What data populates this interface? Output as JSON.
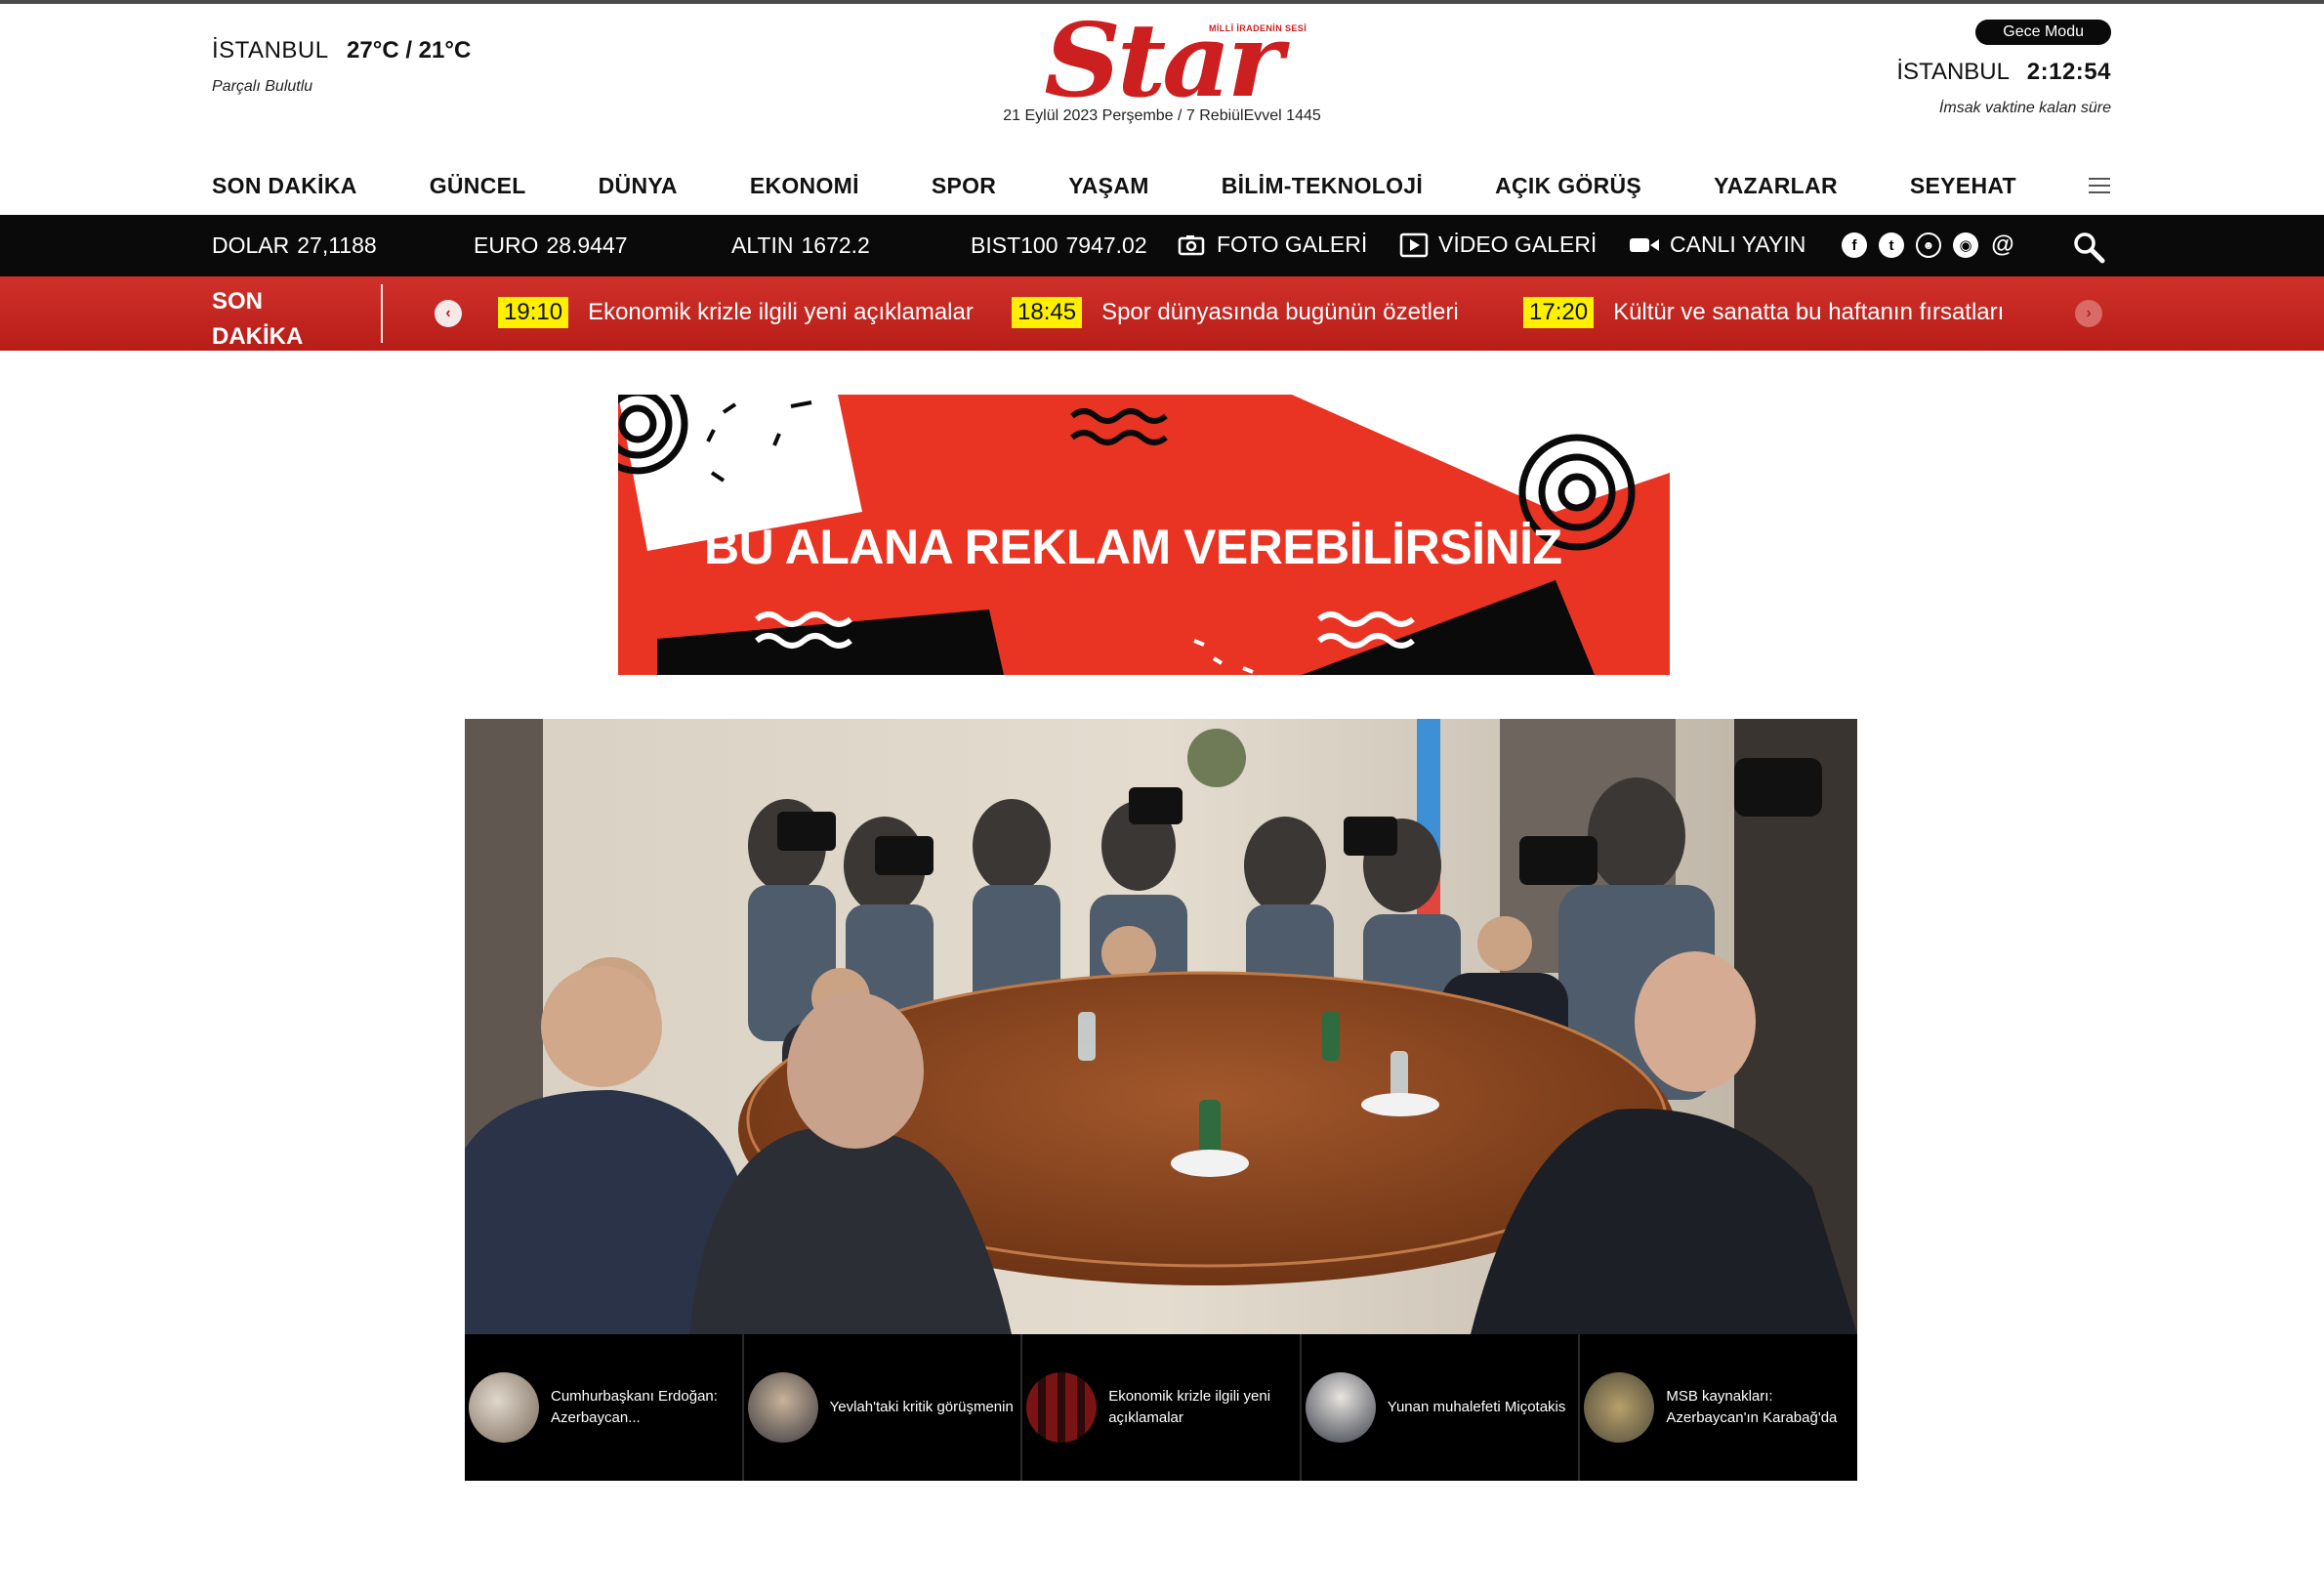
{
  "header": {
    "weather": {
      "city": "İSTANBUL",
      "temp": "27°C / 21°C",
      "desc": "Parçalı Bulutlu"
    },
    "logo": {
      "text": "Star",
      "slogan": "MİLLİ İRADENİN SESİ"
    },
    "date": "21 Eylül 2023 Perşembe / 7 RebiülEvvel 1445",
    "night_mode": "Gece Modu",
    "clock": {
      "city": "İSTANBUL",
      "time": "2:12:54",
      "label": "İmsak vaktine kalan süre"
    }
  },
  "nav": [
    "SON DAKİKA",
    "GÜNCEL",
    "DÜNYA",
    "EKONOMİ",
    "SPOR",
    "YAŞAM",
    "BİLİM-TEKNOLOJİ",
    "AÇIK GÖRÜŞ",
    "YAZARLAR",
    "SEYEHAT"
  ],
  "market": {
    "dolar": {
      "label": "DOLAR",
      "value": "27,1188"
    },
    "euro": {
      "label": "EURO",
      "value": "28.9447"
    },
    "altin": {
      "label": "ALTIN",
      "value": "1672.2"
    },
    "bist": {
      "label": "BIST100",
      "value": "7947.02"
    },
    "foto": "FOTO GALERİ",
    "video": "VİDEO GALERİ",
    "canli": "CANLI YAYIN"
  },
  "socials": [
    "facebook-icon",
    "twitter-icon",
    "reddit-icon",
    "music-icon",
    "email-icon"
  ],
  "breaking": {
    "label_line1": "SON",
    "label_line2": "DAKİKA",
    "items": [
      {
        "time": "19:10",
        "text": "Ekonomik krizle ilgili yeni açıklamalar"
      },
      {
        "time": "18:45",
        "text": "Spor dünyasında bugünün özetleri"
      },
      {
        "time": "17:20",
        "text": "Kültür ve sanatta bu haftanın fırsatları"
      }
    ]
  },
  "ad": {
    "text": "BU ALANA REKLAM VEREBİLİRSİNİZ"
  },
  "thumbs": [
    {
      "caption": "Cumhurbaşkanı Erdoğan: Azerbaycan..."
    },
    {
      "caption": "Yevlah'taki kritik görüşmenin"
    },
    {
      "caption": "Ekonomik krizle ilgili yeni açıklamalar"
    },
    {
      "caption": "Yunan muhalefeti Miçotakis"
    },
    {
      "caption": "MSB kaynakları: Azerbaycan'ın Karabağ'da"
    }
  ],
  "colors": {
    "brand_red": "#cc1f1f",
    "breaking_red": "#c0201b",
    "ticker_time_bg": "#fff000",
    "ad_red": "#e93323"
  }
}
